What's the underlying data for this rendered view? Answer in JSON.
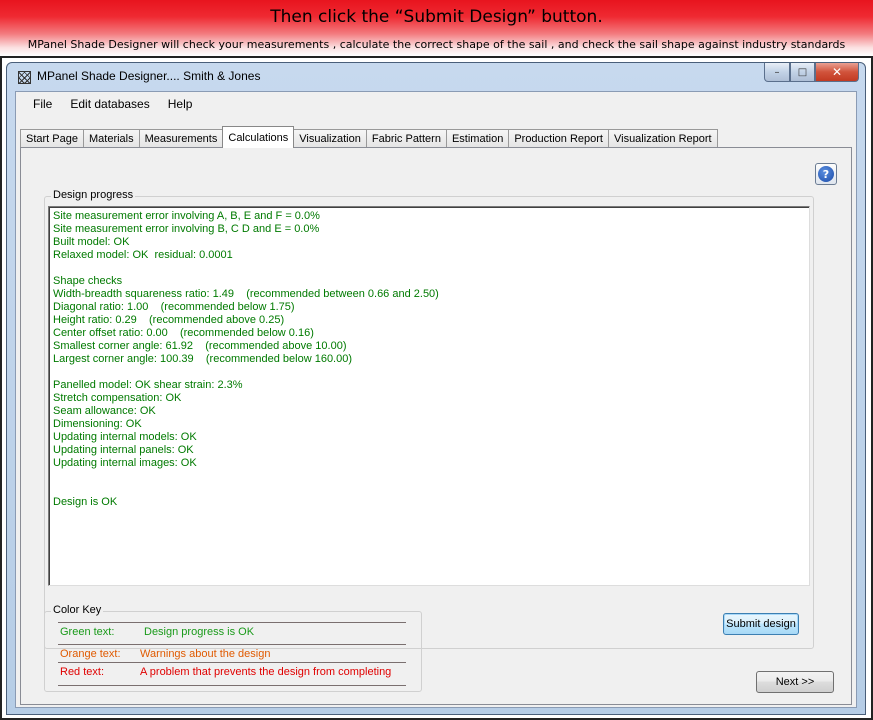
{
  "banner": {
    "title": "Then click the “Submit Design” button.",
    "subtitle": "MPanel Shade Designer will check your measurements , calculate the correct shape of the sail , and check the sail shape against industry standards"
  },
  "window": {
    "title": "MPanel Shade Designer.... Smith & Jones",
    "controls": {
      "minimize": "–",
      "maximize": "□",
      "close": "✕"
    }
  },
  "menu": [
    "File",
    "Edit databases",
    "Help"
  ],
  "tabs": [
    {
      "label": "Start Page",
      "active": false
    },
    {
      "label": "Materials",
      "active": false
    },
    {
      "label": "Measurements",
      "active": false
    },
    {
      "label": "Calculations",
      "active": true
    },
    {
      "label": "Visualization",
      "active": false
    },
    {
      "label": "Fabric Pattern",
      "active": false
    },
    {
      "label": "Estimation",
      "active": false
    },
    {
      "label": "Production Report",
      "active": false
    },
    {
      "label": "Visualization Report",
      "active": false
    }
  ],
  "help_icon": "?",
  "progress": {
    "title": "Design progress",
    "lines": [
      "Site measurement error involving A, B, E and F = 0.0%",
      "Site measurement error involving B, C D and E = 0.0%",
      "Built model: OK",
      "Relaxed model: OK  residual: 0.0001",
      "",
      "Shape checks",
      "Width-breadth squareness ratio: 1.49    (recommended between 0.66 and 2.50)",
      "Diagonal ratio: 1.00    (recommended below 1.75)",
      "Height ratio: 0.29    (recommended above 0.25)",
      "Center offset ratio: 0.00    (recommended below 0.16)",
      "Smallest corner angle: 61.92    (recommended above 10.00)",
      "Largest corner angle: 100.39    (recommended below 160.00)",
      "",
      "Panelled model: OK shear strain: 2.3%",
      "Stretch compensation: OK",
      "Seam allowance: OK",
      "Dimensioning: OK",
      "Updating internal models: OK",
      "Updating internal panels: OK",
      "Updating internal images: OK",
      "",
      "",
      "Design is OK"
    ],
    "text_color": "#007a00"
  },
  "color_key": {
    "title": "Color Key",
    "rows": [
      {
        "label": "Green text:",
        "desc": "Design progress is OK",
        "color": "#1a9a1a"
      },
      {
        "label": "Orange text:",
        "desc": "Warnings about the design",
        "color": "#e05a00"
      },
      {
        "label": "Red text:",
        "desc": "A problem that prevents the design from completing",
        "color": "#e00000"
      }
    ]
  },
  "buttons": {
    "submit": "Submit design",
    "next": "Next >>"
  }
}
